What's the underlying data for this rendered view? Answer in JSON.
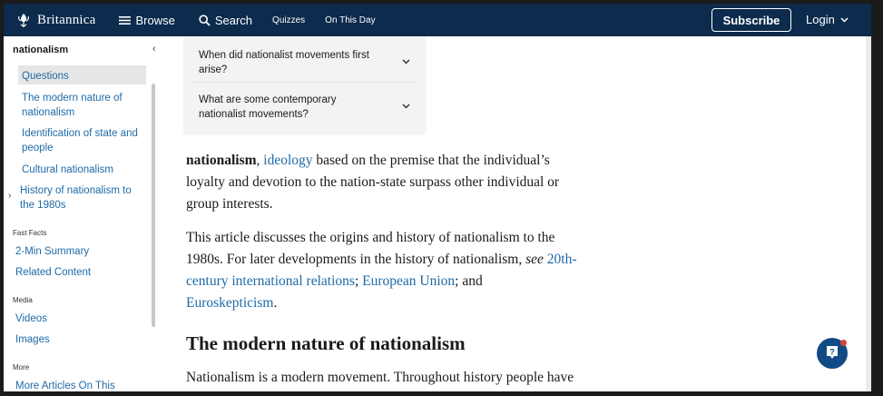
{
  "header": {
    "brand": "Britannica",
    "browse": "Browse",
    "search": "Search",
    "quizzes": "Quizzes",
    "on_this_day": "On This Day",
    "subscribe": "Subscribe",
    "login": "Login"
  },
  "sidebar": {
    "title": "nationalism",
    "collapse": "‹",
    "questions": "Questions",
    "sections": [
      "The modern nature of nationalism",
      "Identification of state and people",
      "Cultural nationalism",
      "History of nationalism to the 1980s"
    ],
    "fast_facts_heading": "Fast Facts",
    "fast_facts": [
      "2-Min Summary",
      "Related Content"
    ],
    "media_heading": "Media",
    "media": [
      "Videos",
      "Images"
    ],
    "more_heading": "More",
    "more": [
      "More Articles On This"
    ]
  },
  "questions_box": {
    "items": [
      "When did nationalist movements first arise?",
      "What are some contemporary nationalist movements?"
    ]
  },
  "article": {
    "p1_term": "nationalism",
    "p1_comma": ",",
    "p1_link": "ideology",
    "p1_rest_line1": " based on the premise that the individual’s",
    "p1_line2": "loyalty and devotion to the nation-state surpass other individual or",
    "p1_line3": "group interests.",
    "p2_line1": "This article discusses the origins and history of nationalism to the",
    "p2_line2_text": "1980s. For later developments in the history of nationalism, ",
    "p2_see": "see",
    "p2_link1a": "20th-",
    "p2_link1b": "century international relations",
    "p2_semi1": "; ",
    "p2_link2": "European Union",
    "p2_and": "; and",
    "p2_link3": "Euroskepticism",
    "p2_end": ".",
    "heading": "The modern nature of nationalism",
    "p3_line1": "Nationalism is a modern movement. Throughout history people have"
  },
  "colors": {
    "header_bg": "#0c2b4d",
    "link": "#1e6aa8",
    "help_button": "#124a86"
  },
  "icons": [
    "thistle-logo-icon",
    "menu-icon",
    "search-icon",
    "chevron-down-icon",
    "help-icon"
  ]
}
